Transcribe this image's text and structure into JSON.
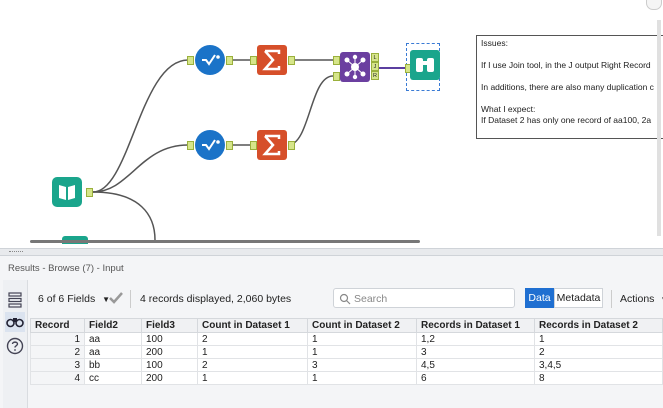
{
  "comment": {
    "lines": [
      "Issues:",
      "",
      "If I use Join tool, in the J output Right Record",
      "",
      "In additions, there are also many duplication c",
      "",
      "What I expect:",
      "If Dataset 2 has only one record of aa100,  2a"
    ]
  },
  "tools": {
    "input_icon": "book-icon",
    "select_icon": "checkmark-circle-icon",
    "summarize_icon": "sigma-icon",
    "join_icon": "join-icon",
    "browse_icon": "binoculars-icon",
    "join_anchors": [
      "L",
      "J",
      "R"
    ]
  },
  "results": {
    "title": "Results - Browse (7) - Input",
    "fields_label": "6 of 6 Fields",
    "records_info": "4 records displayed, 2,060 bytes",
    "search_placeholder": "Search",
    "data_button": "Data",
    "metadata_button": "Metadata",
    "actions_button": "Actions"
  },
  "table": {
    "columns": [
      "Record",
      "Field2",
      "Field3",
      "Count in Dataset 1",
      "Count in Dataset 2",
      "Records in Dataset 1",
      "Records in Dataset 2"
    ],
    "rows": [
      [
        "1",
        "aa",
        "100",
        "2",
        "1",
        "1,2",
        "1"
      ],
      [
        "2",
        "aa",
        "200",
        "1",
        "1",
        "3",
        "2"
      ],
      [
        "3",
        "bb",
        "100",
        "2",
        "3",
        "4,5",
        "3,4,5"
      ],
      [
        "4",
        "cc",
        "200",
        "1",
        "1",
        "6",
        "8"
      ]
    ]
  },
  "colors": {
    "accent": "#1f6fd1",
    "select_tool": "#1b73c8",
    "summarize_tool": "#d64f2a",
    "join_tool": "#6b3fa0",
    "browse_tool": "#1aa58c",
    "input_tool": "#1aa58c"
  }
}
